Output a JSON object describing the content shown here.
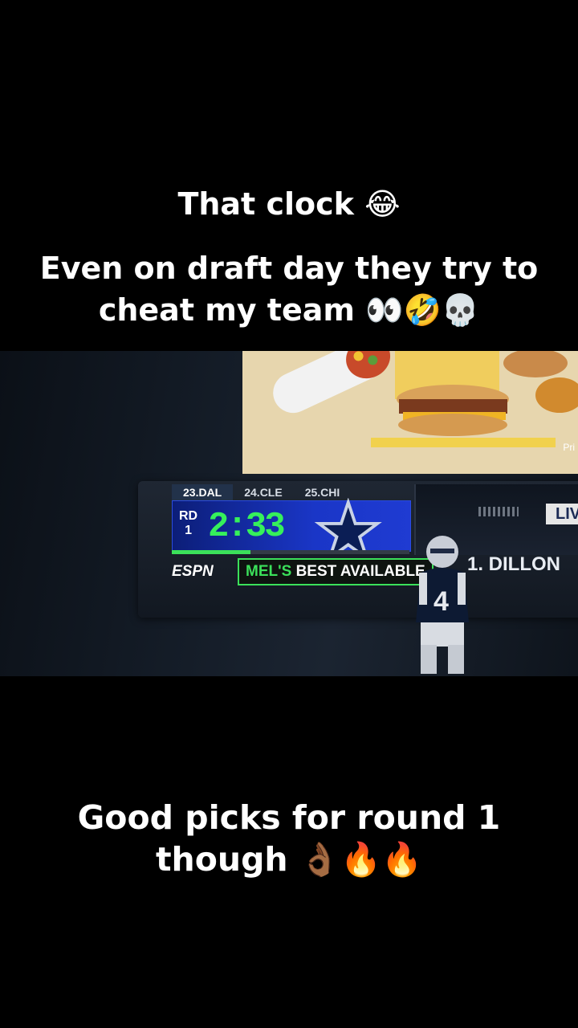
{
  "captions": {
    "top": "That clock 😂",
    "second": "Even on draft day they try to cheat my team 👀🤣💀",
    "bottom": "Good picks for round 1 though 👌🏾🔥🔥"
  },
  "scoreboard": {
    "picks": [
      "23.DAL",
      "24.CLE",
      "25.CHI"
    ],
    "round_label": "RD",
    "round_number": "1",
    "clock": "2:33",
    "network": "ESPN",
    "best_available_prefix": "MEL'S",
    "best_available_suffix": "BEST AVAILABLE",
    "ticker": "1. DILLON",
    "live_label": "LIV",
    "clock_progress_fraction": 0.33
  },
  "ad": {
    "corner_text": "Pri"
  },
  "colors": {
    "clock_green": "#36f05b",
    "panel_blue": "#1a36c7",
    "accent_green": "#3be05a"
  },
  "icons": {
    "team_logo": "cowboys-star-icon",
    "player": "dallas-quarterback-sticker"
  }
}
